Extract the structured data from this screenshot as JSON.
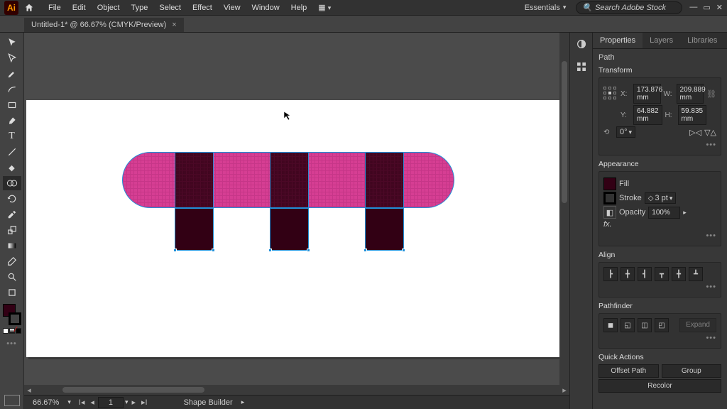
{
  "app": {
    "logo": "Ai"
  },
  "menu": {
    "items": [
      "File",
      "Edit",
      "Object",
      "Type",
      "Select",
      "Effect",
      "View",
      "Window",
      "Help"
    ]
  },
  "workspace": {
    "label": "Essentials"
  },
  "search": {
    "placeholder": "Search Adobe Stock"
  },
  "doc": {
    "tab_title": "Untitled-1* @ 66.67% (CMYK/Preview)"
  },
  "status": {
    "zoom": "66.67%",
    "artboard_index": "1",
    "tool": "Shape Builder"
  },
  "properties": {
    "tabs": {
      "properties": "Properties",
      "layers": "Layers",
      "libraries": "Libraries"
    },
    "selection_type": "Path",
    "transform": {
      "title": "Transform",
      "x": "173.876 mm",
      "y": "64.882 mm",
      "w": "209.889 mm",
      "h": "59.835 mm",
      "rotation": "0°"
    },
    "appearance": {
      "title": "Appearance",
      "fill": "Fill",
      "stroke": "Stroke",
      "stroke_weight": "3 pt",
      "opacity_label": "Opacity",
      "opacity": "100%",
      "fx": "fx."
    },
    "align": {
      "title": "Align"
    },
    "pathfinder": {
      "title": "Pathfinder",
      "expand": "Expand"
    },
    "quick_actions": {
      "title": "Quick Actions",
      "offset_path": "Offset Path",
      "group": "Group",
      "recolor": "Recolor"
    }
  }
}
